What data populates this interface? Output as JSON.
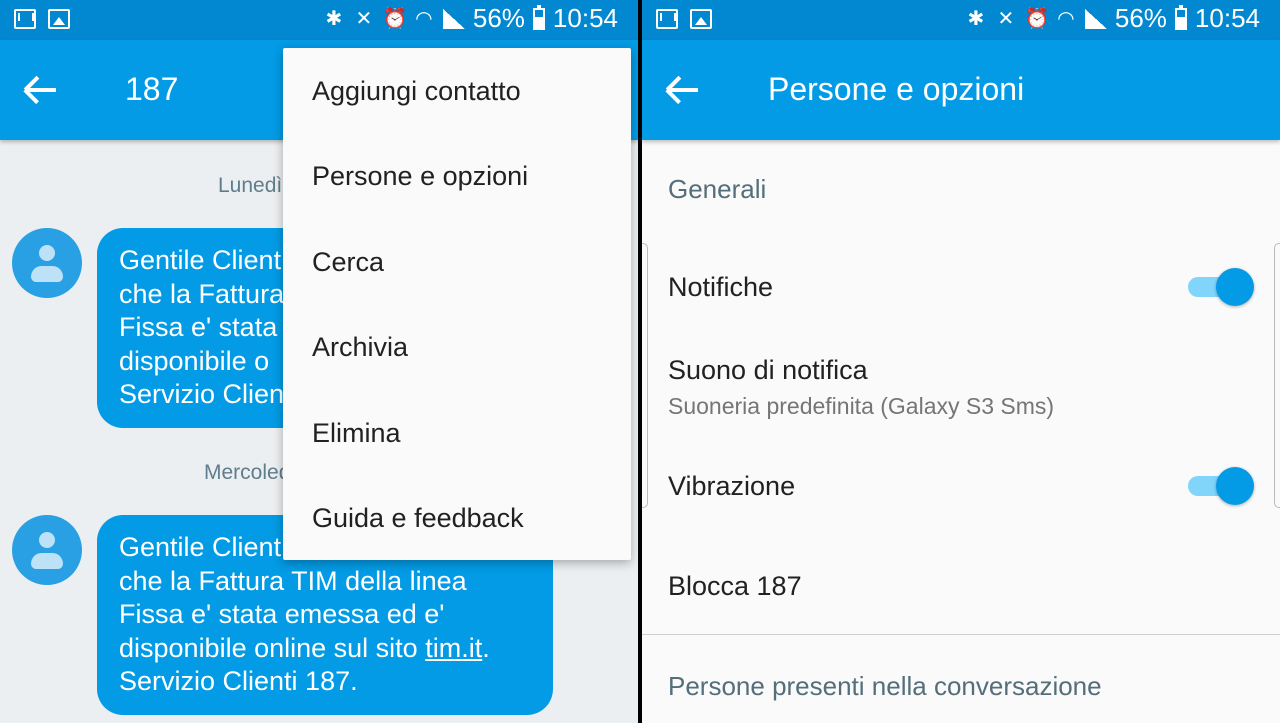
{
  "status_bar": {
    "battery": "56%",
    "time": "10:54",
    "icons": [
      "mail-icon",
      "image-icon",
      "bluetooth-icon",
      "mute-icon",
      "alarm-icon",
      "wifi-icon",
      "signal-icon",
      "battery-icon"
    ]
  },
  "conversation": {
    "title": "187",
    "date_1": "Lunedì",
    "date_2": "Mercoled",
    "message_1_lines": [
      "Gentile Client",
      "che la Fattura",
      "Fissa e' stata",
      "disponibile o",
      "Servizio Clien"
    ],
    "message_2": {
      "line_1": "Gentile Client",
      "line_2": "che la Fattura TIM della linea",
      "line_3": "Fissa e' stata emessa ed e'",
      "line_4_text": "disponibile online sul sito ",
      "line_4_link": "tim.it",
      "line_4_end": ".",
      "line_5": "Servizio Clienti 187."
    }
  },
  "overflow_menu": {
    "items": [
      "Aggiungi contatto",
      "Persone e opzioni",
      "Cerca",
      "Archivia",
      "Elimina",
      "Guida e feedback"
    ]
  },
  "settings": {
    "title": "Persone e opzioni",
    "section_general": "Generali",
    "notifications_label": "Notifiche",
    "notifications_on": true,
    "sound_label": "Suono di notifica",
    "sound_value": "Suoneria predefinita (Galaxy S3 Sms)",
    "vibration_label": "Vibrazione",
    "vibration_on": true,
    "block_label": "Blocca 187",
    "section_people": "Persone presenti nella conversazione"
  },
  "colors": {
    "status_bar": "#0288d1",
    "app_bar": "#039be5",
    "bubble": "#039be5",
    "toggle_thumb": "#039be5",
    "toggle_track": "#81d4fa"
  }
}
